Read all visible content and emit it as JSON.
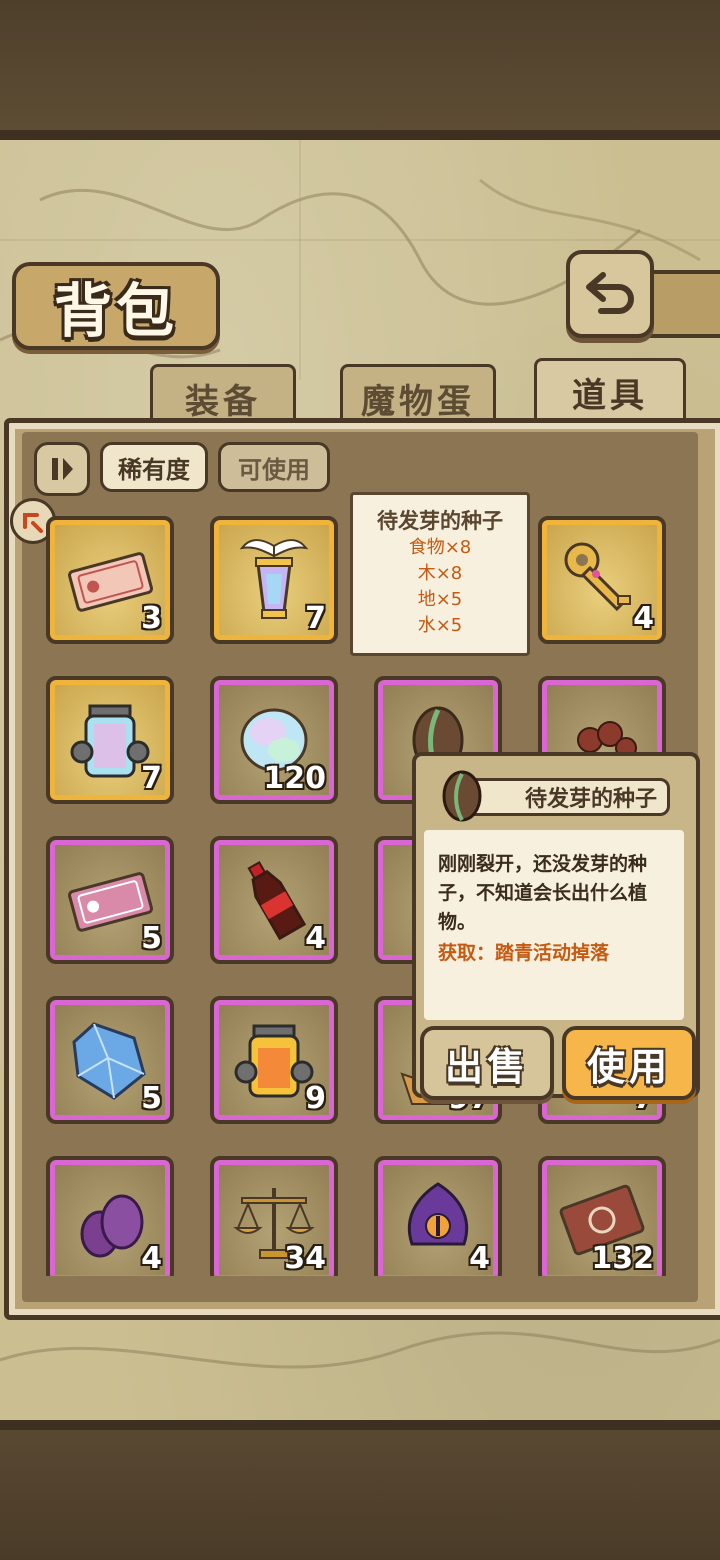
{
  "header": {
    "title": "背包",
    "back_icon": "back-arrow-icon"
  },
  "tabs": [
    {
      "label": "装备",
      "active": false
    },
    {
      "label": "魔物蛋",
      "active": false
    },
    {
      "label": "道具",
      "active": true
    }
  ],
  "filters": {
    "sort_icon": "sort-toggle-icon",
    "rarity_label": "稀有度",
    "usable_label": "可使用"
  },
  "items": [
    {
      "name": "ticket-icon",
      "count": "3",
      "frame": "gold"
    },
    {
      "name": "winged-lantern-icon",
      "count": "7",
      "frame": "gold"
    },
    {
      "name": "seed-icon",
      "count": "",
      "frame": "gold"
    },
    {
      "name": "golden-key-icon",
      "count": "4",
      "frame": "gold"
    },
    {
      "name": "rainbow-lamp-icon",
      "count": "7",
      "frame": "gold"
    },
    {
      "name": "rainbow-egg-icon",
      "count": "120",
      "frame": "pink"
    },
    {
      "name": "seed-icon",
      "count": "",
      "frame": "pink"
    },
    {
      "name": "berries-icon",
      "count": "",
      "frame": "pink"
    },
    {
      "name": "pink-ticket-icon",
      "count": "5",
      "frame": "pink"
    },
    {
      "name": "cola-bottle-icon",
      "count": "4",
      "frame": "pink"
    },
    {
      "name": "hidden-item-icon",
      "count": "",
      "frame": "pink"
    },
    {
      "name": "hidden-item-icon",
      "count": "",
      "frame": "pink"
    },
    {
      "name": "blue-crystal-icon",
      "count": "5",
      "frame": "pink"
    },
    {
      "name": "fire-lamp-icon",
      "count": "9",
      "frame": "pink"
    },
    {
      "name": "bread-basket-icon",
      "count": "97",
      "frame": "pink"
    },
    {
      "name": "hidden-item-icon",
      "count": "7",
      "frame": "pink"
    },
    {
      "name": "purple-eggs-icon",
      "count": "4",
      "frame": "pink"
    },
    {
      "name": "scales-icon",
      "count": "34",
      "frame": "pink"
    },
    {
      "name": "tentacle-eye-icon",
      "count": "4",
      "frame": "pink"
    },
    {
      "name": "brown-card-icon",
      "count": "132",
      "frame": "pink"
    }
  ],
  "recipe_tip": {
    "title": "待发芽的种子",
    "lines": [
      "食物×8",
      "木×8",
      "地×5",
      "水×5"
    ]
  },
  "detail": {
    "name": "待发芽的种子",
    "description": "刚刚裂开，还没发芽的种子，不知道会长出什么植物。",
    "source": "获取：踏青活动掉落",
    "sell_label": "出售",
    "use_label": "使用"
  },
  "colors": {
    "gold_frame": "#f0b43a",
    "pink_frame": "#d966d2",
    "accent_orange": "#c55a13",
    "use_button": "#f7b64a"
  }
}
